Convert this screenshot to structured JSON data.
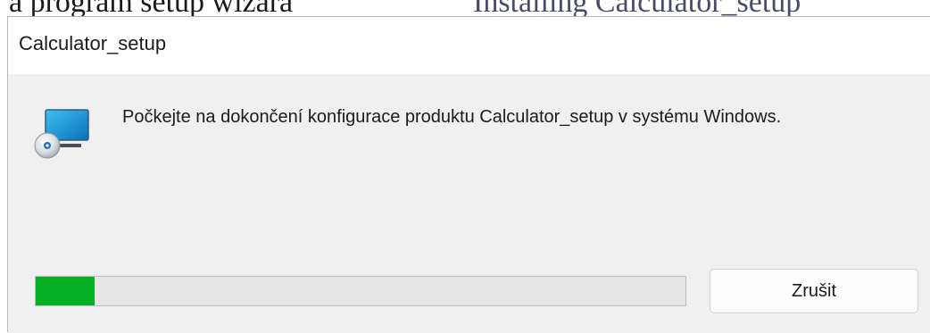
{
  "window": {
    "title": "Calculator_setup"
  },
  "background": {
    "left_text": "a program setup wizara",
    "right_text": "Installing Calculator_setup"
  },
  "dialog": {
    "message": "Počkejte na dokončení konfigurace produktu Calculator_setup v systému Windows.",
    "icon": "installer-monitor-disc-icon",
    "progress_fraction": 0.09,
    "cancel_label": "Zrušit"
  },
  "colors": {
    "progress_fill": "#06b025",
    "progress_track": "#e6e6e6",
    "dialog_body": "#f0f0f0",
    "titlebar": "#ffffff"
  }
}
